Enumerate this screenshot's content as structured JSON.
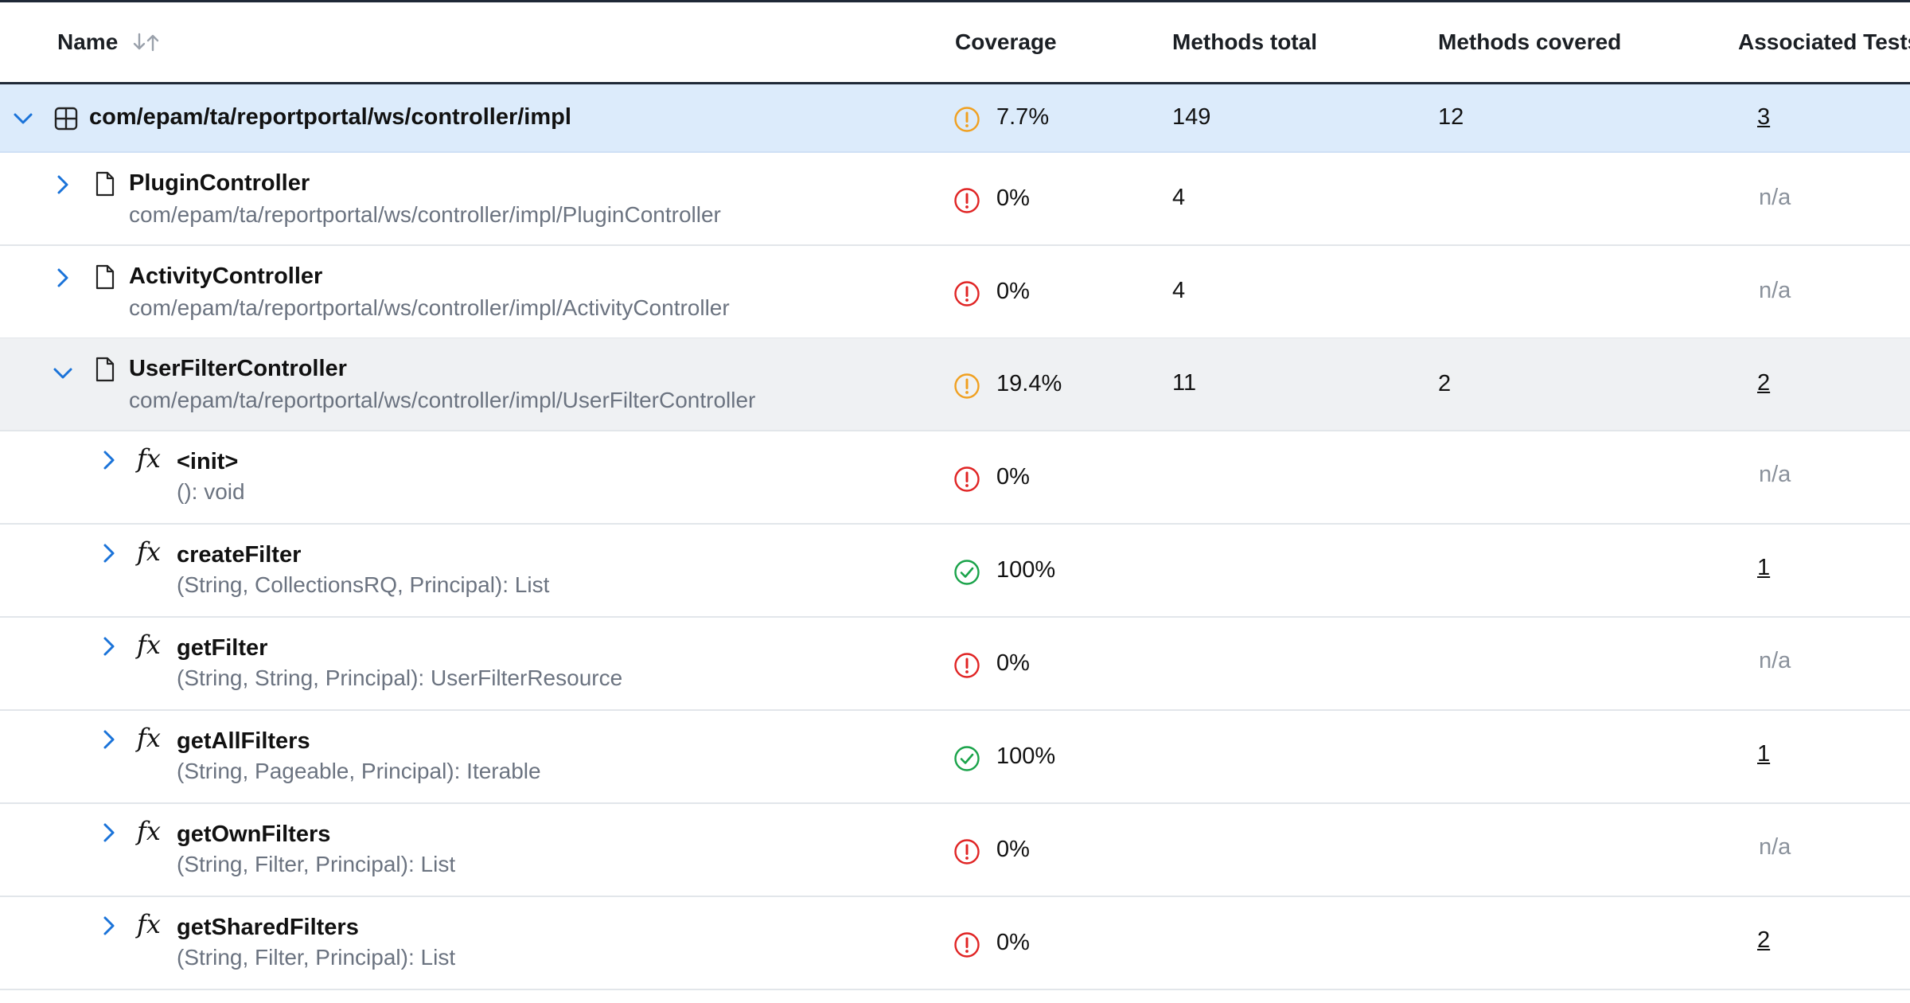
{
  "header": {
    "name": "Name",
    "coverage": "Coverage",
    "methods_total": "Methods total",
    "methods_covered": "Methods covered",
    "associated_tests": "Associated Tests"
  },
  "package_row": {
    "name": "com/epam/ta/reportportal/ws/controller/impl",
    "coverage": "7.7%",
    "coverage_status": "warning",
    "methods_total": "149",
    "methods_covered": "12",
    "tests": "3"
  },
  "class_rows": [
    {
      "name": "PluginController",
      "path": "com/epam/ta/reportportal/ws/controller/impl/PluginController",
      "coverage": "0%",
      "coverage_status": "error",
      "methods_total": "4",
      "tests": "n/a"
    },
    {
      "name": "ActivityController",
      "path": "com/epam/ta/reportportal/ws/controller/impl/ActivityController",
      "coverage": "0%",
      "coverage_status": "error",
      "methods_total": "4",
      "tests": "n/a"
    },
    {
      "name": "UserFilterController",
      "path": "com/epam/ta/reportportal/ws/controller/impl/UserFilterController",
      "coverage": "19.4%",
      "coverage_status": "warning",
      "methods_total": "11",
      "methods_covered": "2",
      "tests": "2"
    }
  ],
  "method_rows": [
    {
      "name": "<init>",
      "signature": "(): void",
      "coverage": "0%",
      "coverage_status": "error",
      "tests": "n/a"
    },
    {
      "name": "createFilter",
      "signature": "(String, CollectionsRQ, Principal): List",
      "coverage": "100%",
      "coverage_status": "ok",
      "tests": "1"
    },
    {
      "name": "getFilter",
      "signature": "(String, String, Principal): UserFilterResource",
      "coverage": "0%",
      "coverage_status": "error",
      "tests": "n/a"
    },
    {
      "name": "getAllFilters",
      "signature": "(String, Pageable, Principal): Iterable",
      "coverage": "100%",
      "coverage_status": "ok",
      "tests": "1"
    },
    {
      "name": "getOwnFilters",
      "signature": "(String, Filter, Principal): List",
      "coverage": "0%",
      "coverage_status": "error",
      "tests": "n/a"
    },
    {
      "name": "getSharedFilters",
      "signature": "(String, Filter, Principal): List",
      "coverage": "0%",
      "coverage_status": "error",
      "tests": "2"
    }
  ],
  "colors": {
    "chevron": "#1a73d9",
    "selected_row": "#dcebfb",
    "expanded_row": "#eff1f3",
    "error": "#e02424",
    "warning": "#f0a020",
    "ok": "#1aa34a",
    "muted_text": "#6b7380"
  }
}
